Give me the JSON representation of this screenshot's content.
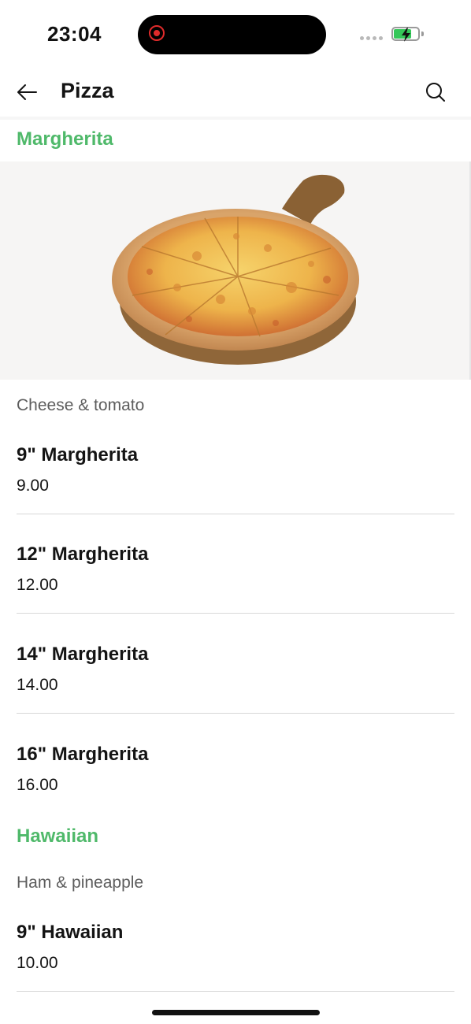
{
  "status_bar": {
    "time": "23:04",
    "recording_icon": "screen-record-icon",
    "signal_icon": "signal-dots-icon",
    "battery_icon": "battery-charging-icon",
    "battery_color": "#35c759"
  },
  "header": {
    "title": "Pizza",
    "back_icon": "arrow-left-icon",
    "search_icon": "search-icon"
  },
  "colors": {
    "accent": "#4fb96a",
    "text": "#141414",
    "muted": "#5d5d5d",
    "divider": "#d8d8d8"
  },
  "sections": [
    {
      "title": "Margherita",
      "image": "pizza-on-wooden-board",
      "description": "Cheese & tomato",
      "items": [
        {
          "name": "9\" Margherita",
          "price": "9.00"
        },
        {
          "name": "12\" Margherita",
          "price": "12.00"
        },
        {
          "name": "14\" Margherita",
          "price": "14.00"
        },
        {
          "name": "16\" Margherita",
          "price": "16.00"
        }
      ]
    },
    {
      "title": "Hawaiian",
      "description": "Ham & pineapple",
      "items": [
        {
          "name": "9\" Hawaiian",
          "price": "10.00"
        }
      ]
    }
  ]
}
